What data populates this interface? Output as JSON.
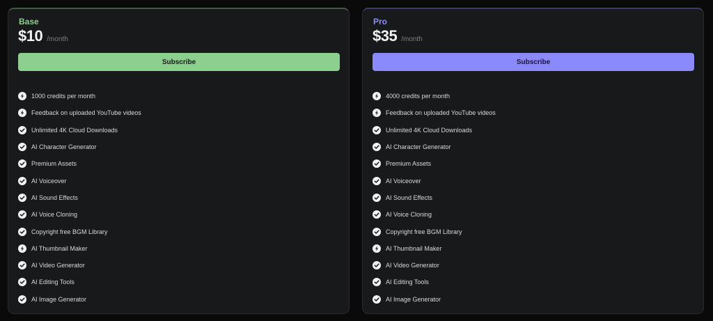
{
  "plans": [
    {
      "name": "Base",
      "price": "$10",
      "period": "/month",
      "button_label": "Subscribe",
      "accent_color": "#8dcf8f",
      "features": [
        {
          "label": "1000 credits per month",
          "icon": "bolt-icon"
        },
        {
          "label": "Feedback on uploaded YouTube videos",
          "icon": "bolt-icon"
        },
        {
          "label": "Unlimited 4K Cloud Downloads",
          "icon": "check-icon"
        },
        {
          "label": "AI Character Generator",
          "icon": "check-icon"
        },
        {
          "label": "Premium Assets",
          "icon": "check-icon"
        },
        {
          "label": "AI Voiceover",
          "icon": "check-icon"
        },
        {
          "label": "AI Sound Effects",
          "icon": "check-icon"
        },
        {
          "label": "AI Voice Cloning",
          "icon": "check-icon"
        },
        {
          "label": "Copyright free BGM Library",
          "icon": "check-icon"
        },
        {
          "label": "AI Thumbnail Maker",
          "icon": "bolt-icon"
        },
        {
          "label": "AI Video Generator",
          "icon": "check-icon"
        },
        {
          "label": "AI Editing Tools",
          "icon": "check-icon"
        },
        {
          "label": "AI Image Generator",
          "icon": "check-icon"
        }
      ]
    },
    {
      "name": "Pro",
      "price": "$35",
      "period": "/month",
      "button_label": "Subscribe",
      "accent_color": "#8a8afc",
      "features": [
        {
          "label": "4000 credits per month",
          "icon": "bolt-icon"
        },
        {
          "label": "Feedback on uploaded YouTube videos",
          "icon": "bolt-icon"
        },
        {
          "label": "Unlimited 4K Cloud Downloads",
          "icon": "check-icon"
        },
        {
          "label": "AI Character Generator",
          "icon": "check-icon"
        },
        {
          "label": "Premium Assets",
          "icon": "check-icon"
        },
        {
          "label": "AI Voiceover",
          "icon": "check-icon"
        },
        {
          "label": "AI Sound Effects",
          "icon": "check-icon"
        },
        {
          "label": "AI Voice Cloning",
          "icon": "check-icon"
        },
        {
          "label": "Copyright free BGM Library",
          "icon": "check-icon"
        },
        {
          "label": "AI Thumbnail Maker",
          "icon": "bolt-icon"
        },
        {
          "label": "AI Video Generator",
          "icon": "check-icon"
        },
        {
          "label": "AI Editing Tools",
          "icon": "check-icon"
        },
        {
          "label": "AI Image Generator",
          "icon": "check-icon"
        }
      ]
    }
  ]
}
